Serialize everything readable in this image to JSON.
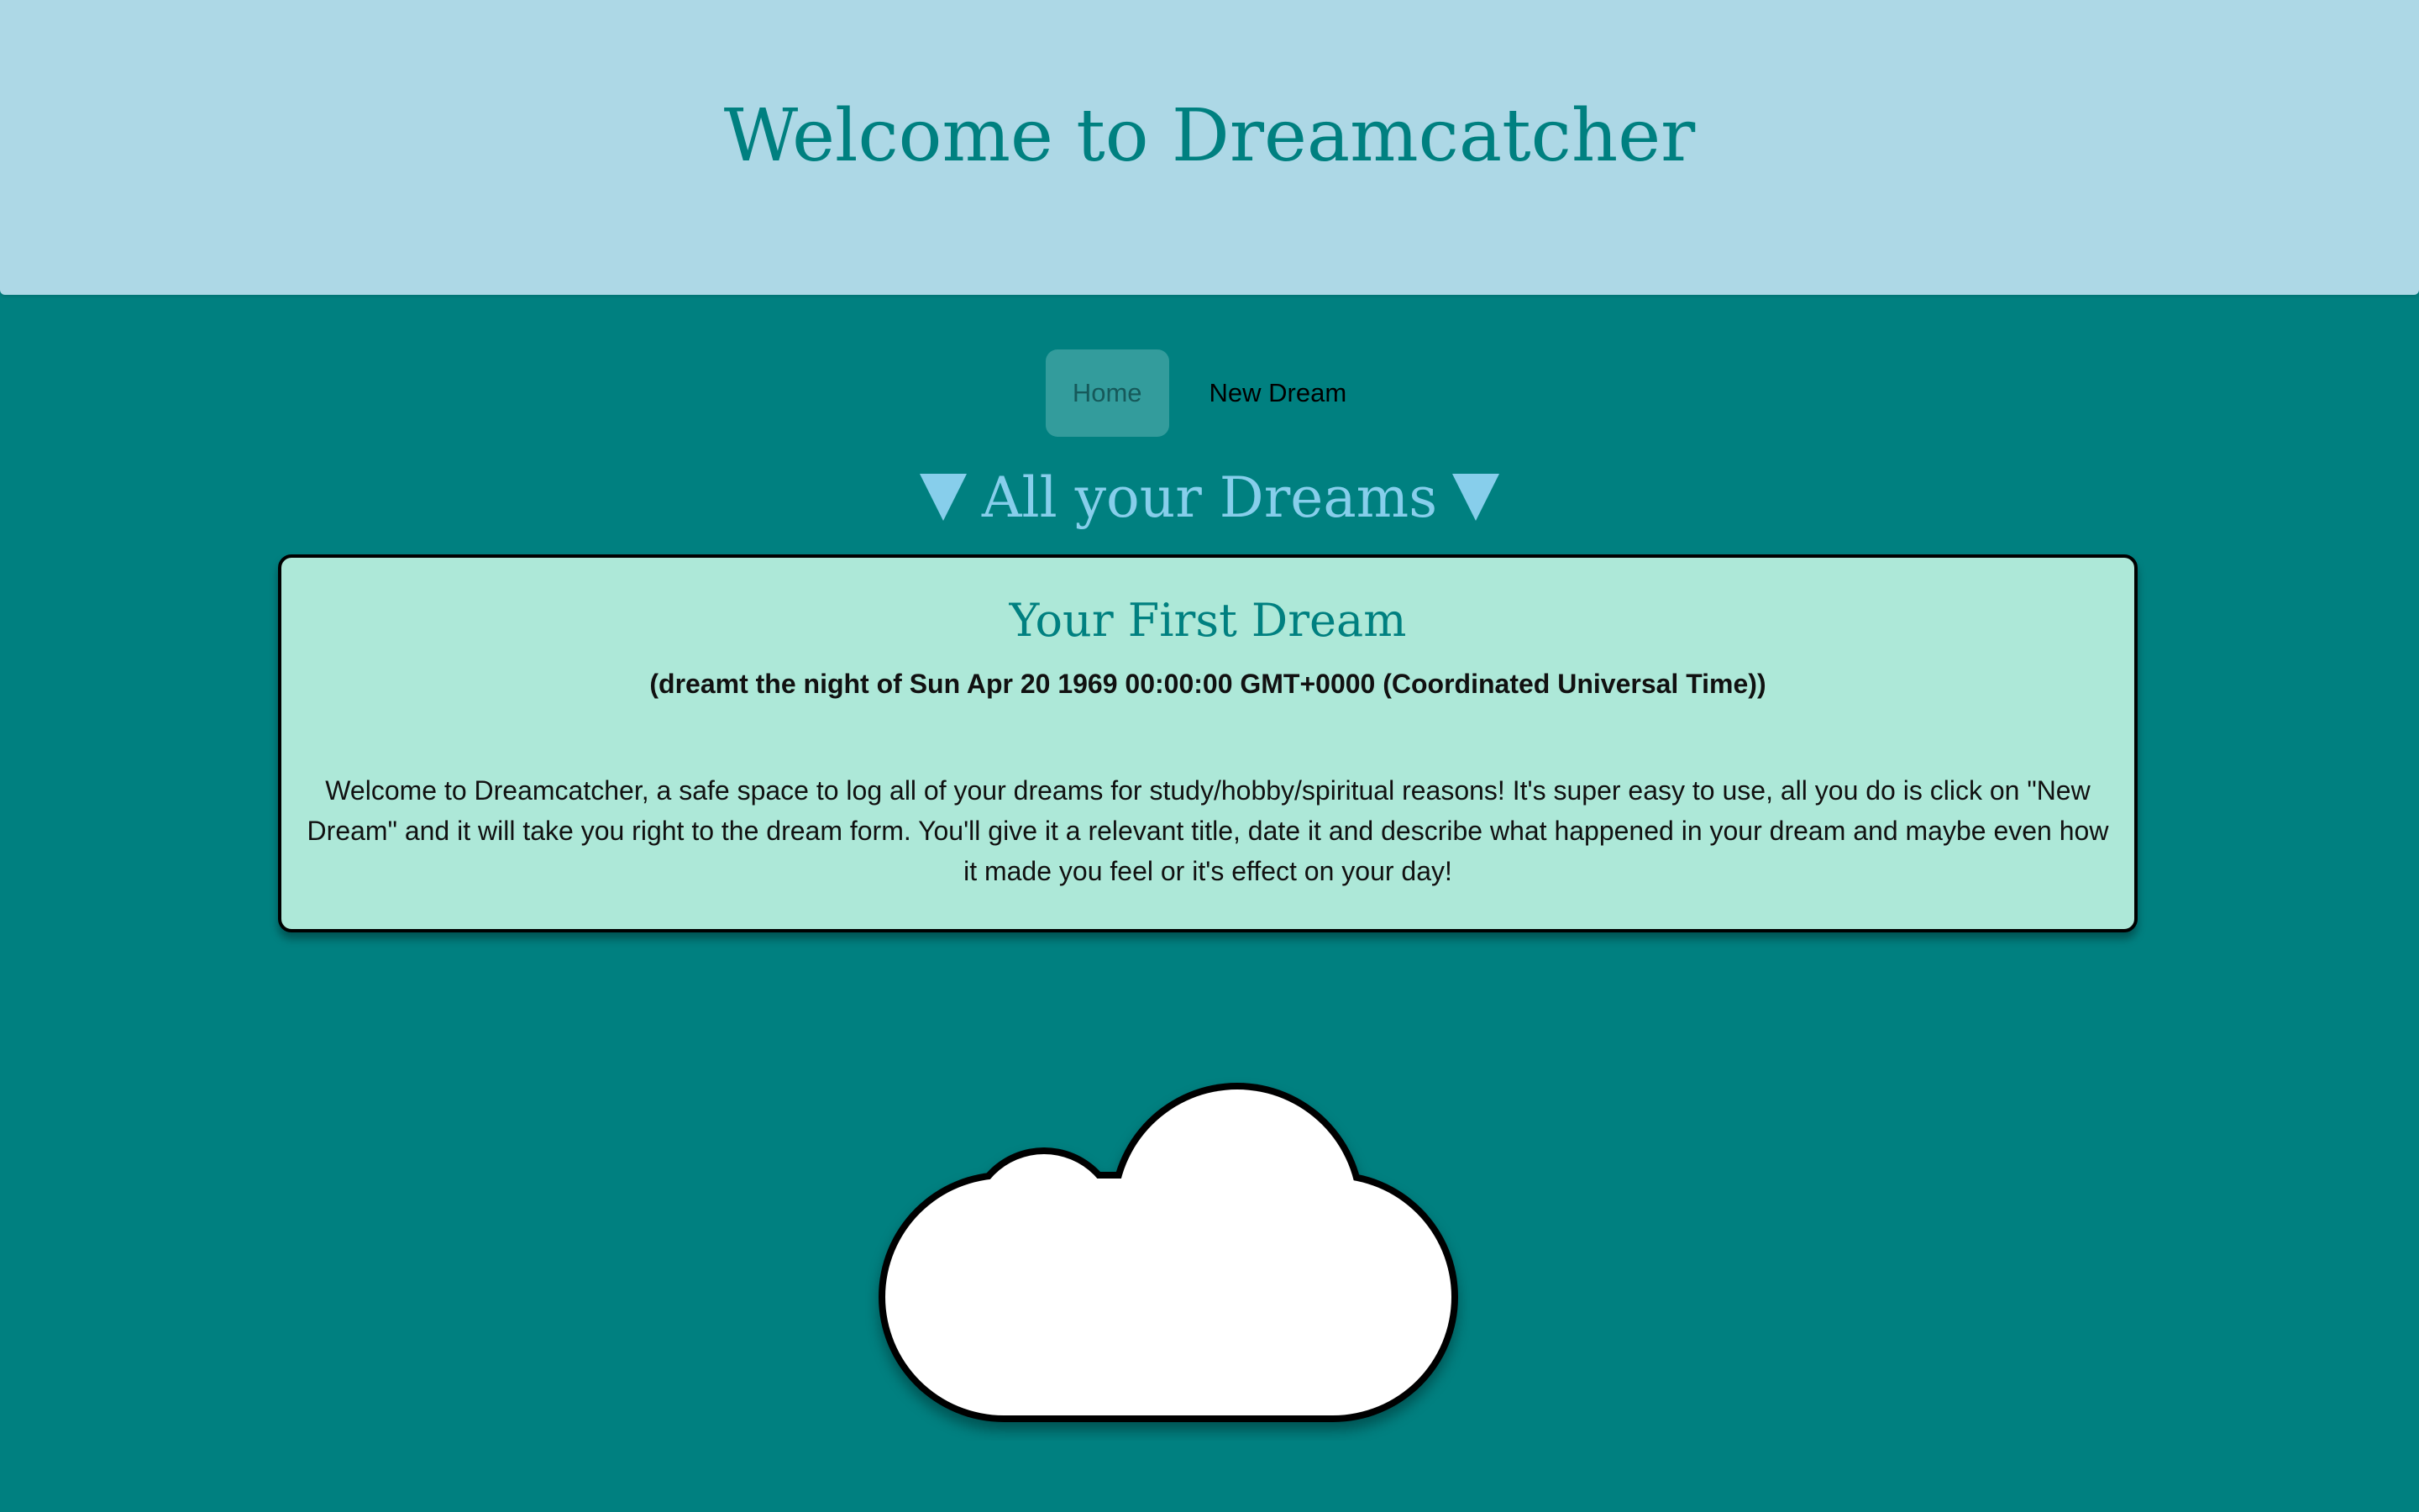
{
  "header": {
    "title": "Welcome to Dreamcatcher"
  },
  "nav": {
    "items": [
      {
        "label": "Home",
        "active": true
      },
      {
        "label": "New Dream",
        "active": false
      }
    ]
  },
  "section": {
    "heading": "All your Dreams",
    "arrow_icon": "down-triangle-icon"
  },
  "dreams": [
    {
      "title": "Your First Dream",
      "date": "(dreamt the night of Sun Apr 20 1969 00:00:00 GMT+0000 (Coordinated Universal Time))",
      "body": "Welcome to Dreamcatcher, a safe space to log all of your dreams for study/hobby/spiritual reasons! It's super easy to use, all you do is click on \"New Dream\" and it will take you right to the dream form. You'll give it a relevant title, date it and describe what happened in your dream and maybe even how it made you feel or it's effect on your day!"
    }
  ],
  "decoration": {
    "icon": "cloud-icon"
  },
  "colors": {
    "background": "#008080",
    "header": "#add8e6",
    "title": "#008080",
    "heading": "#87ceeb",
    "card": "#ade8d8",
    "nav_active": "#339c9c"
  }
}
